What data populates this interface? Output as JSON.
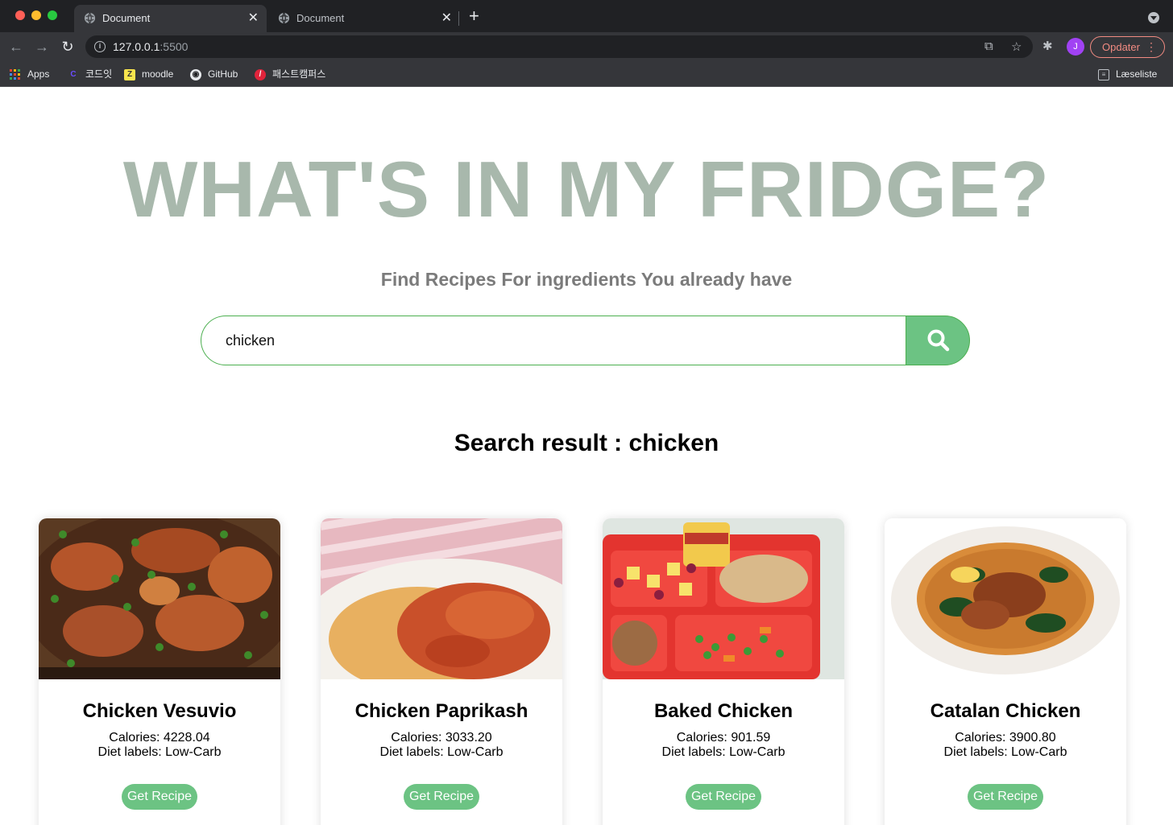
{
  "browser": {
    "tabs": [
      {
        "title": "Document",
        "active": true
      },
      {
        "title": "Document",
        "active": false
      }
    ],
    "url_host": "127.0.0.1",
    "url_port": ":5500",
    "profile_initial": "J",
    "update_label": "Opdater",
    "bookmarks": [
      {
        "label": "Apps",
        "icon": "apps-grid-icon"
      },
      {
        "label": "코드잇",
        "icon": "codeit-icon"
      },
      {
        "label": "moodle",
        "icon": "moodle-icon"
      },
      {
        "label": "GitHub",
        "icon": "github-icon"
      },
      {
        "label": "패스트캠퍼스",
        "icon": "fastcampus-icon"
      }
    ],
    "reading_list_label": "Læseliste"
  },
  "page": {
    "title": "WHAT'S IN MY FRIDGE?",
    "subtitle": "Find Recipes For ingredients You already have",
    "search": {
      "value": "chicken",
      "button_icon": "search-icon"
    },
    "result_heading": "Search result : chicken",
    "recipes": [
      {
        "name": "Chicken Vesuvio",
        "calories": "Calories: 4228.04",
        "diet": "Diet labels: Low-Carb",
        "button": "Get Recipe"
      },
      {
        "name": "Chicken Paprikash",
        "calories": "Calories: 3033.20",
        "diet": "Diet labels: Low-Carb",
        "button": "Get Recipe"
      },
      {
        "name": "Baked Chicken",
        "calories": "Calories: 901.59",
        "diet": "Diet labels: Low-Carb",
        "button": "Get Recipe"
      },
      {
        "name": "Catalan Chicken",
        "calories": "Calories: 3900.80",
        "diet": "Diet labels: Low-Carb",
        "button": "Get Recipe"
      }
    ]
  },
  "colors": {
    "title": "#a8b8ac",
    "accent_green": "#6cc383",
    "border_green": "#4caf50",
    "subtitle": "#7b7b7b"
  }
}
